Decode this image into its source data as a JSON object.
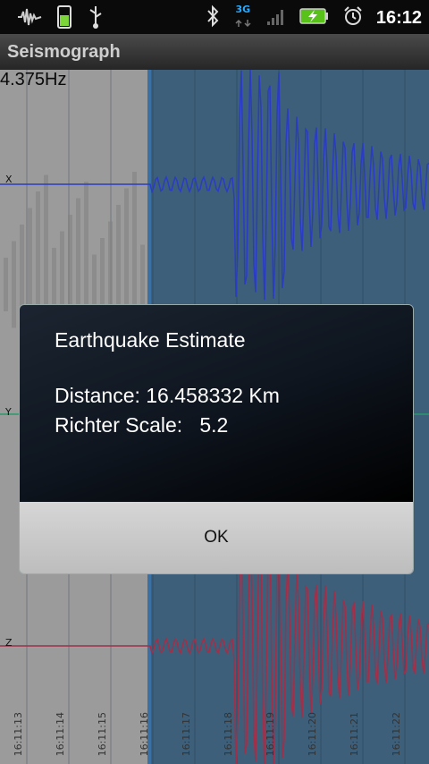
{
  "status_bar": {
    "time": "16:12",
    "network_type": "3G",
    "icons": [
      "waveform-icon",
      "battery-app-icon",
      "usb-icon",
      "bluetooth-icon",
      "signal-icon",
      "charging-battery-icon",
      "alarm-icon"
    ]
  },
  "app": {
    "title": "Seismograph"
  },
  "plot": {
    "frequency": "4.375Hz",
    "axes": {
      "x_label": "X",
      "y_label": "Y",
      "z_label": "Z"
    },
    "time_labels": [
      "16:11:13",
      "16:11:14",
      "16:11:15",
      "16:11:16",
      "16:11:17",
      "16:11:18",
      "16:11:19",
      "16:11:20",
      "16:11:21",
      "16:11:22"
    ]
  },
  "dialog": {
    "title": "Earthquake Estimate",
    "distance_label": "Distance:",
    "distance_value": "16.458332 Km",
    "richter_label": "Richter Scale:",
    "richter_value": "5.2",
    "ok_label": "OK"
  },
  "colors": {
    "plot_bg": "#3d5f7a",
    "past_overlay": "#9b9b9b",
    "x_trace": "#2b3cc4",
    "z_trace": "#a0304a",
    "y_trace": "#2a9a6a"
  }
}
